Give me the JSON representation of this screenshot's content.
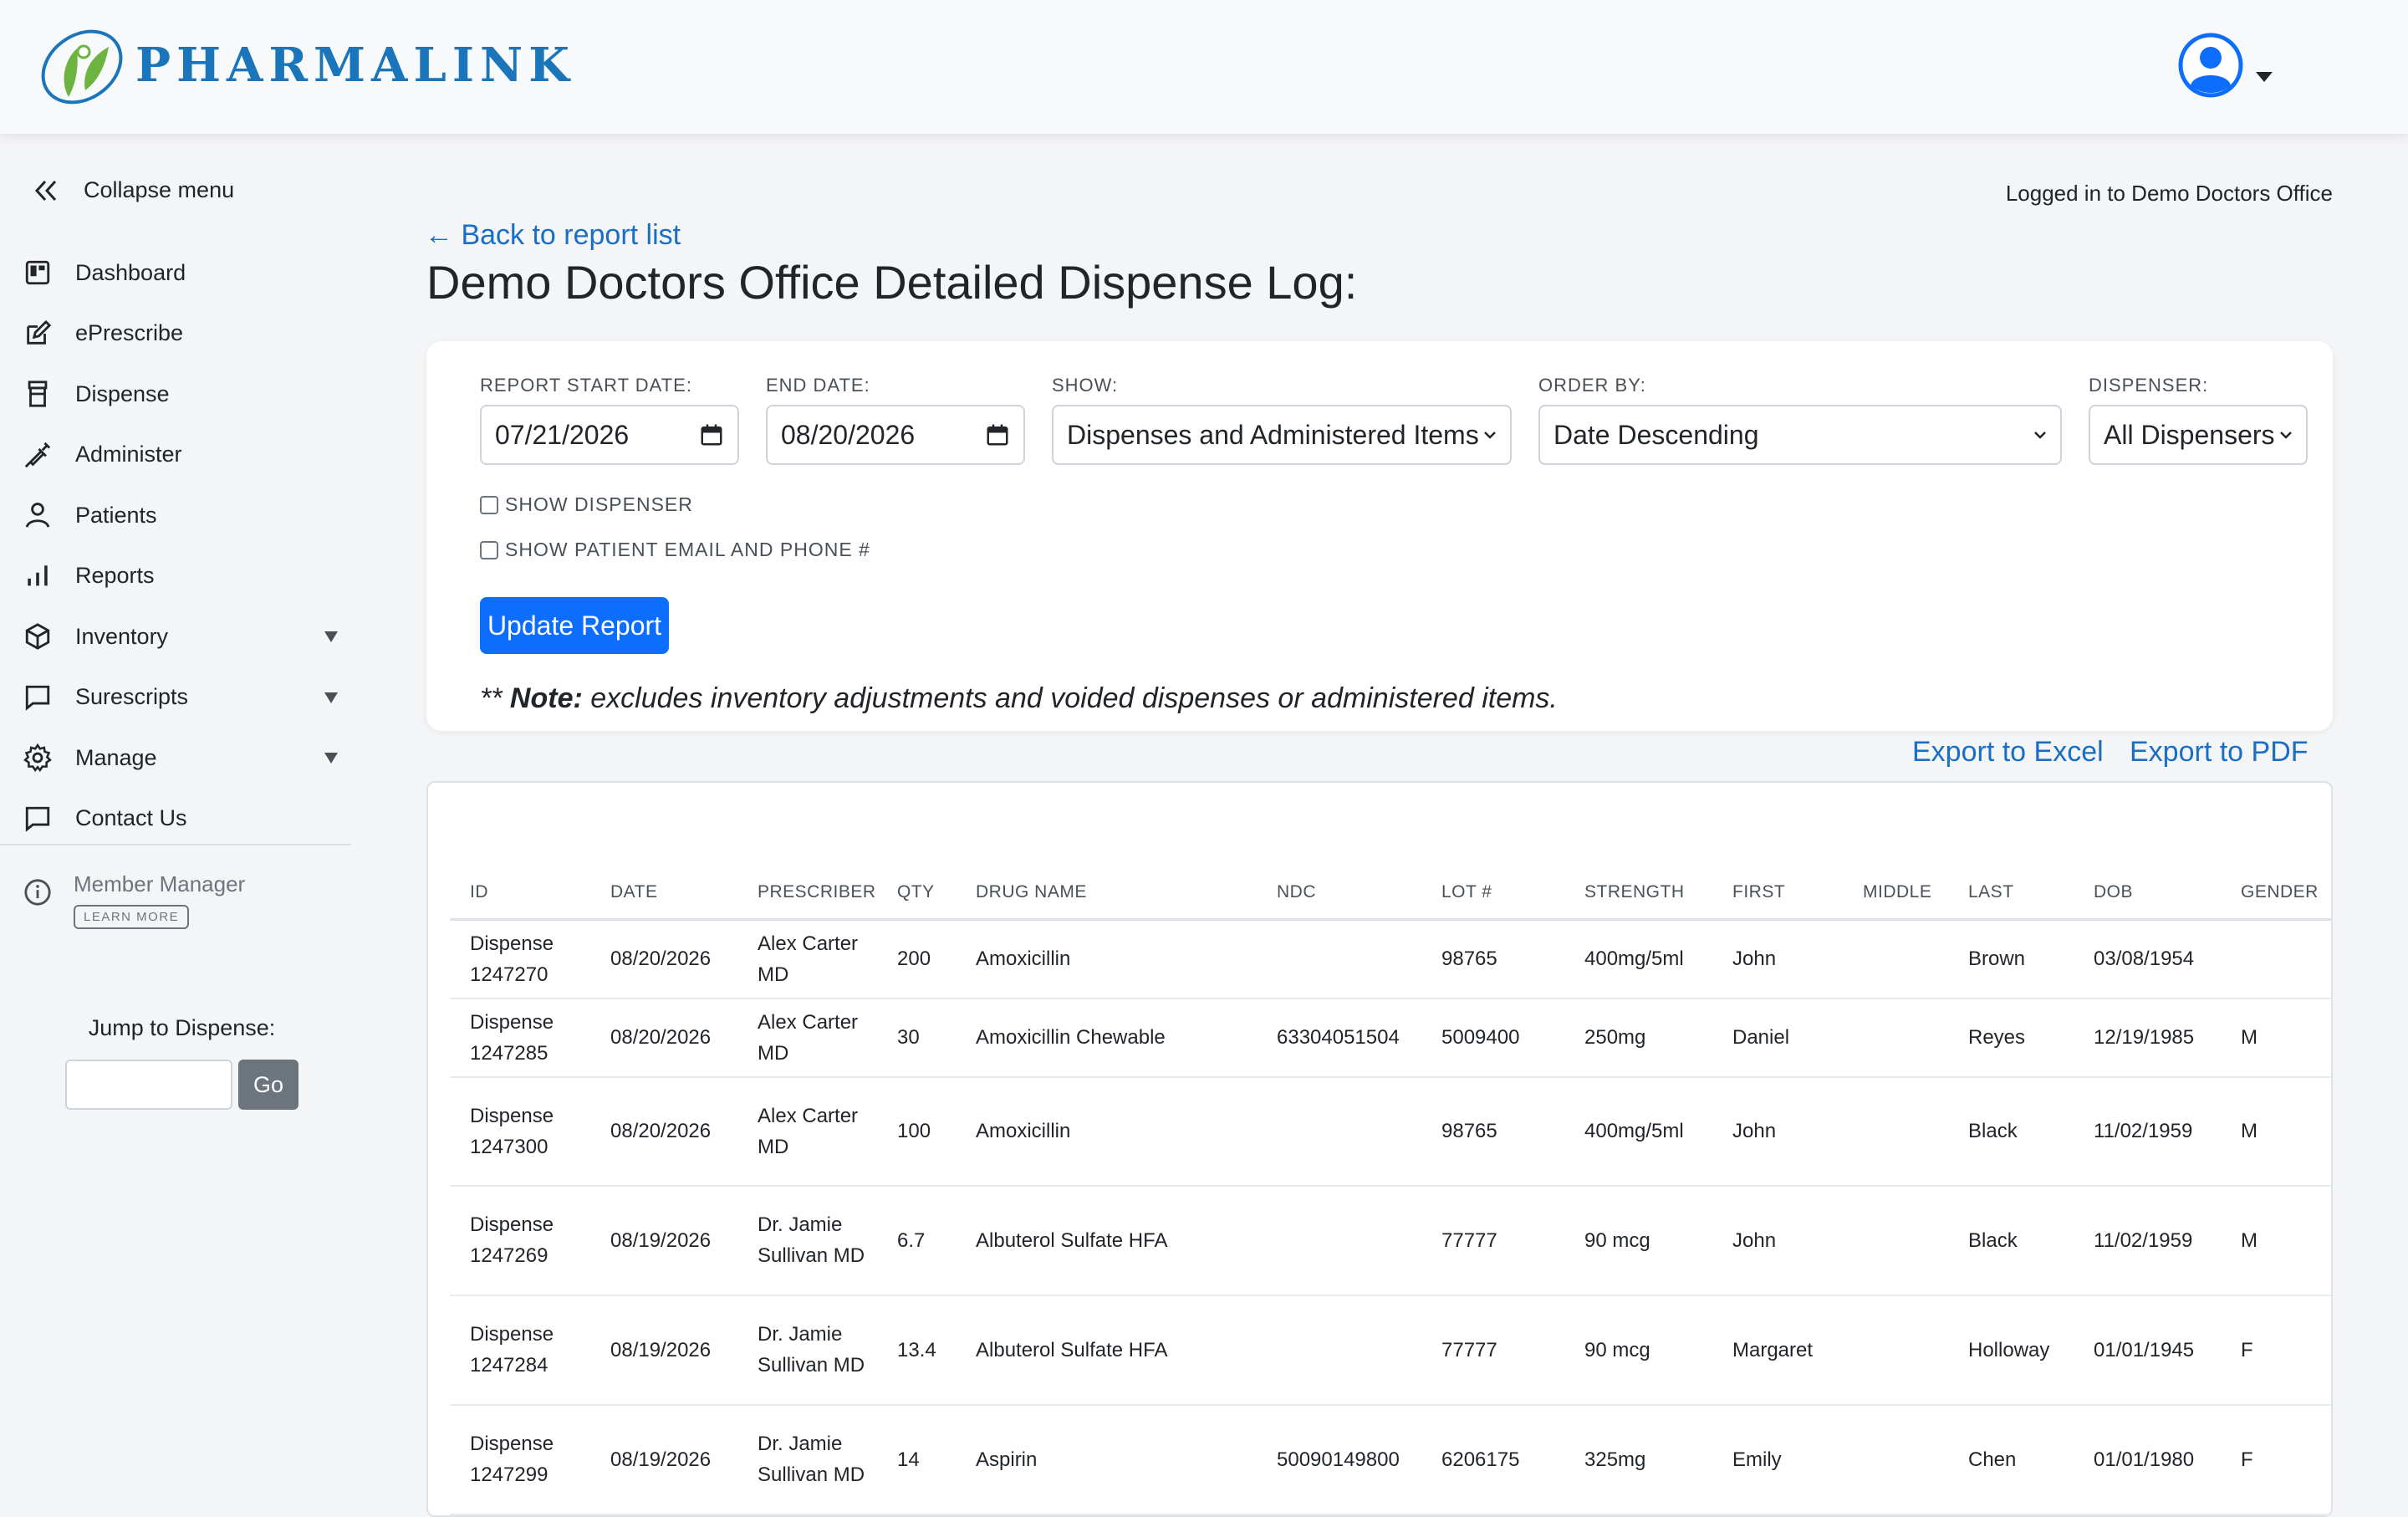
{
  "header": {
    "brand": "PHARMALINK"
  },
  "sidebar": {
    "collapse_label": "Collapse menu",
    "items": [
      {
        "label": "Dashboard",
        "icon": "dashboard-icon",
        "caret": false
      },
      {
        "label": "ePrescribe",
        "icon": "edit-icon",
        "caret": false
      },
      {
        "label": "Dispense",
        "icon": "pill-bottle-icon",
        "caret": false
      },
      {
        "label": "Administer",
        "icon": "syringe-icon",
        "caret": false
      },
      {
        "label": "Patients",
        "icon": "person-icon",
        "caret": false
      },
      {
        "label": "Reports",
        "icon": "bar-chart-icon",
        "caret": false
      },
      {
        "label": "Inventory",
        "icon": "box-icon",
        "caret": true
      },
      {
        "label": "Surescripts",
        "icon": "chat-icon",
        "caret": true
      },
      {
        "label": "Manage",
        "icon": "gear-icon",
        "caret": true
      },
      {
        "label": "Contact Us",
        "icon": "chat-icon",
        "caret": false
      }
    ],
    "member_manager": "Member Manager",
    "learn_more": "LEARN MORE",
    "jump_label": "Jump to Dispense:",
    "go_label": "Go"
  },
  "main": {
    "logged_in": "Logged in to Demo Doctors Office",
    "back_link": "← Back to report list",
    "title": "Demo Doctors Office Detailed Dispense Log:"
  },
  "filters": {
    "start_label": "REPORT START DATE:",
    "start_value": "07/21/2026",
    "end_label": "END DATE:",
    "end_value": "08/20/2026",
    "show_label": "SHOW:",
    "show_value": "Dispenses and Administered Items",
    "order_label": "ORDER BY:",
    "order_value": "Date Descending",
    "dispenser_label": "DISPENSER:",
    "dispenser_value": "All Dispensers",
    "show_dispenser": "SHOW DISPENSER",
    "show_contact": "SHOW PATIENT EMAIL AND PHONE #",
    "update_button": "Update Report",
    "note_prefix": "** ",
    "note_bold": "Note:",
    "note_text": " excludes inventory adjustments and voided dispenses or administered items."
  },
  "export": {
    "excel": "Export to Excel",
    "pdf": "Export to PDF"
  },
  "table": {
    "columns": [
      "ID",
      "DATE",
      "PRESCRIBER",
      "QTY",
      "DRUG NAME",
      "NDC",
      "LOT #",
      "STRENGTH",
      "FIRST",
      "MIDDLE",
      "LAST",
      "DOB",
      "GENDER"
    ],
    "rows": [
      [
        "Dispense 1247270",
        "08/20/2026",
        "Alex Carter MD",
        "200",
        "Amoxicillin",
        "",
        "98765",
        "400mg/5ml",
        "John",
        "",
        "Brown",
        "03/08/1954",
        ""
      ],
      [
        "Dispense 1247285",
        "08/20/2026",
        "Alex Carter MD",
        "30",
        "Amoxicillin Chewable",
        "63304051504",
        "5009400",
        "250mg",
        "Daniel",
        "",
        "Reyes",
        "12/19/1985",
        "M"
      ],
      [
        "Dispense 1247300",
        "08/20/2026",
        "Alex Carter MD",
        "100",
        "Amoxicillin",
        "",
        "98765",
        "400mg/5ml",
        "John",
        "",
        "Black",
        "11/02/1959",
        "M"
      ],
      [
        "Dispense 1247269",
        "08/19/2026",
        "Dr. Jamie Sullivan MD",
        "6.7",
        "Albuterol Sulfate HFA",
        "",
        "77777",
        "90 mcg",
        "John",
        "",
        "Black",
        "11/02/1959",
        "M"
      ],
      [
        "Dispense 1247284",
        "08/19/2026",
        "Dr. Jamie Sullivan MD",
        "13.4",
        "Albuterol Sulfate HFA",
        "",
        "77777",
        "90 mcg",
        "Margaret",
        "",
        "Holloway",
        "01/01/1945",
        "F"
      ],
      [
        "Dispense 1247299",
        "08/19/2026",
        "Dr. Jamie Sullivan MD",
        "14",
        "Aspirin",
        "50090149800",
        "6206175",
        "325mg",
        "Emily",
        "",
        "Chen",
        "01/01/1980",
        "F"
      ]
    ]
  }
}
